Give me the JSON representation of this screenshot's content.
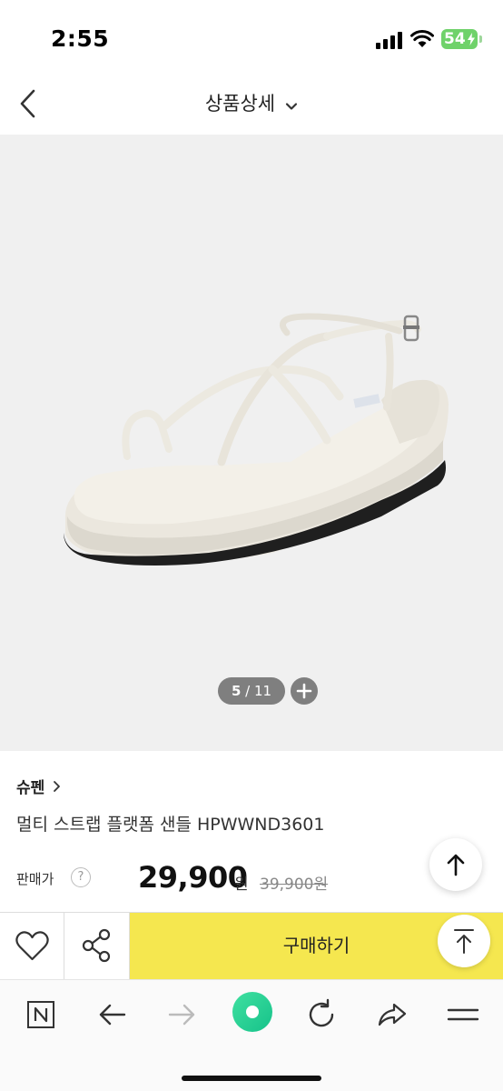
{
  "status_bar": {
    "time": "2:55",
    "battery": "54"
  },
  "header": {
    "title": "상품상세"
  },
  "gallery": {
    "current": "5",
    "separator": " / ",
    "total": "11"
  },
  "product": {
    "brand": "슈펜",
    "name": "멀티 스트랩 플랫폼 샌들 HPWWND3601",
    "price_label": "판매가",
    "help": "?",
    "price": "29,900",
    "price_unit": "원",
    "original_price": "39,900원",
    "discount_partial": "%"
  },
  "actions": {
    "buy_label": "구매하기"
  },
  "colors": {
    "buy_button": "#f5e74f",
    "discount": "#e8402f",
    "battery": "#6fd26a",
    "browser_home": "#2fd38a",
    "image_bg": "#f0f0f0"
  },
  "icons": {
    "back": "chevron-left-icon",
    "title_dropdown": "chevron-down-icon",
    "zoom": "plus-icon",
    "like": "heart-icon",
    "share": "share-icon",
    "scroll_top": "arrow-up-icon",
    "top": "arrow-up-to-top-icon",
    "browser": [
      "n-logo-icon",
      "arrow-left-icon",
      "arrow-right-icon",
      "green-dot-icon",
      "reload-icon",
      "forward-share-icon",
      "menu-icon"
    ]
  }
}
